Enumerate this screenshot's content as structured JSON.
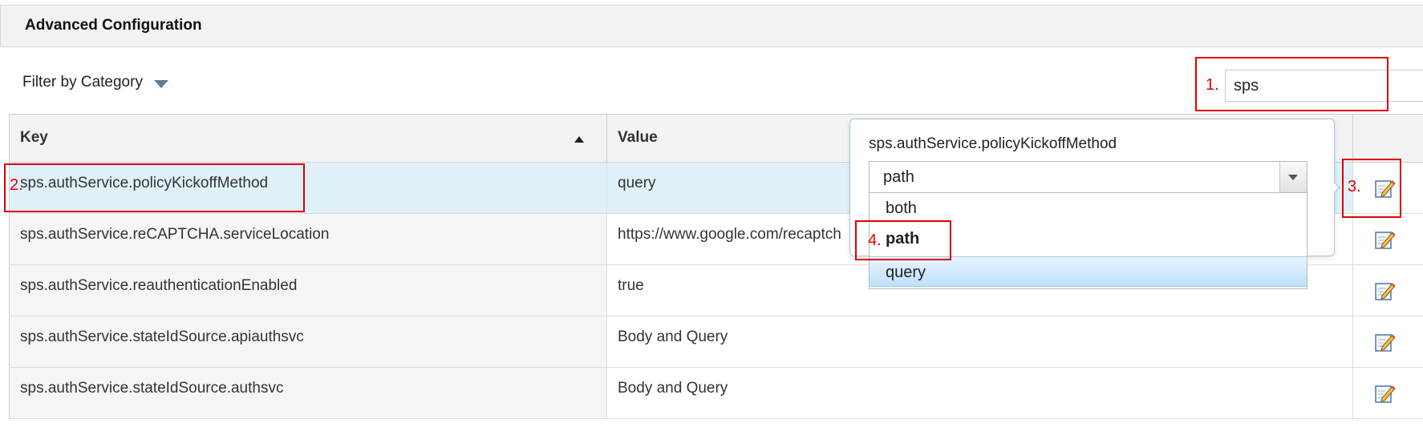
{
  "header": {
    "title": "Advanced Configuration"
  },
  "filter": {
    "label": "Filter by Category",
    "caret_icon": "caret-down-icon"
  },
  "search": {
    "value": "sps"
  },
  "table": {
    "columns": {
      "key": "Key",
      "value": "Value",
      "sort": "ascending"
    },
    "rows": [
      {
        "key": "sps.authService.policyKickoffMethod",
        "value": "query",
        "selected": true
      },
      {
        "key": "sps.authService.reCAPTCHA.serviceLocation",
        "value": "https://www.google.com/recaptch"
      },
      {
        "key": "sps.authService.reauthenticationEnabled",
        "value": "true"
      },
      {
        "key": "sps.authService.stateIdSource.apiauthsvc",
        "value": "Body and Query"
      },
      {
        "key": "sps.authService.stateIdSource.authsvc",
        "value": "Body and Query"
      }
    ],
    "action_icon": "edit-icon"
  },
  "popover": {
    "title": "sps.authService.policyKickoffMethod",
    "select_value": "path",
    "options": [
      "both",
      "path",
      "query"
    ]
  },
  "annotations": [
    "1.",
    "2.",
    "3.",
    "4."
  ],
  "colors": {
    "annotation": "#e00000",
    "selected_row": "#dff0f8",
    "hover_option": "#bfe1fb"
  }
}
